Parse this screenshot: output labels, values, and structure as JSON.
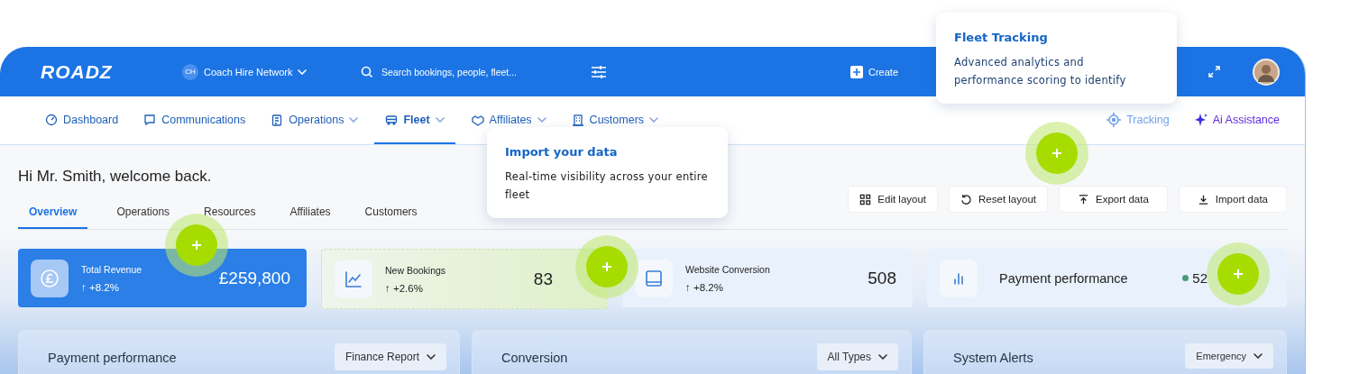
{
  "topbar": {
    "logo": "ROADZ",
    "workspace": {
      "initials": "CH",
      "name": "Coach Hire Network"
    },
    "search": {
      "placeholder": "Search bookings, people, fleet..."
    },
    "create": "Create"
  },
  "nav": {
    "items": [
      {
        "label": "Dashboard",
        "dropdown": false,
        "selected": false
      },
      {
        "label": "Communications",
        "dropdown": false,
        "selected": false
      },
      {
        "label": "Operations",
        "dropdown": true,
        "selected": false
      },
      {
        "label": "Fleet",
        "dropdown": true,
        "selected": true
      },
      {
        "label": "Affiliates",
        "dropdown": true,
        "selected": false
      },
      {
        "label": "Customers",
        "dropdown": true,
        "selected": false
      }
    ],
    "tracking": "Tracking",
    "assistant": "Ai Assistance"
  },
  "greeting": "Hi Mr. Smith, welcome back.",
  "tabs": [
    {
      "label": "Overview",
      "selected": true
    },
    {
      "label": "Operations",
      "selected": false
    },
    {
      "label": "Resources",
      "selected": false
    },
    {
      "label": "Affiliates",
      "selected": false
    },
    {
      "label": "Customers",
      "selected": false
    }
  ],
  "actions": [
    {
      "label": "Edit layout"
    },
    {
      "label": "Reset layout"
    },
    {
      "label": "Export data"
    },
    {
      "label": "Import data"
    }
  ],
  "stats": [
    {
      "kind": "primary",
      "title": "Total Revenue",
      "change": "↑ +8.2%",
      "value": "£259,800"
    },
    {
      "kind": "success",
      "title": "New Bookings",
      "change": "↑ +2.6%",
      "value": "83"
    },
    {
      "kind": "plain",
      "title": "Website Conversion",
      "change": "↑ +8.2%",
      "value": "508"
    },
    {
      "kind": "large",
      "title": "Payment performance",
      "value": "52",
      "color": "#4a9a7a"
    }
  ],
  "panels": [
    {
      "title": "Payment performance",
      "filter": "Finance Report"
    },
    {
      "title": "Conversion",
      "filter": "All Types"
    },
    {
      "title": "System Alerts",
      "filter": "Emergency"
    }
  ],
  "tooltips": [
    {
      "title": "Fleet Tracking",
      "text": "Advanced analytics and performance scoring to identify"
    },
    {
      "title": "Import your data",
      "text": "Real-time visibility across your entire fleet"
    }
  ]
}
